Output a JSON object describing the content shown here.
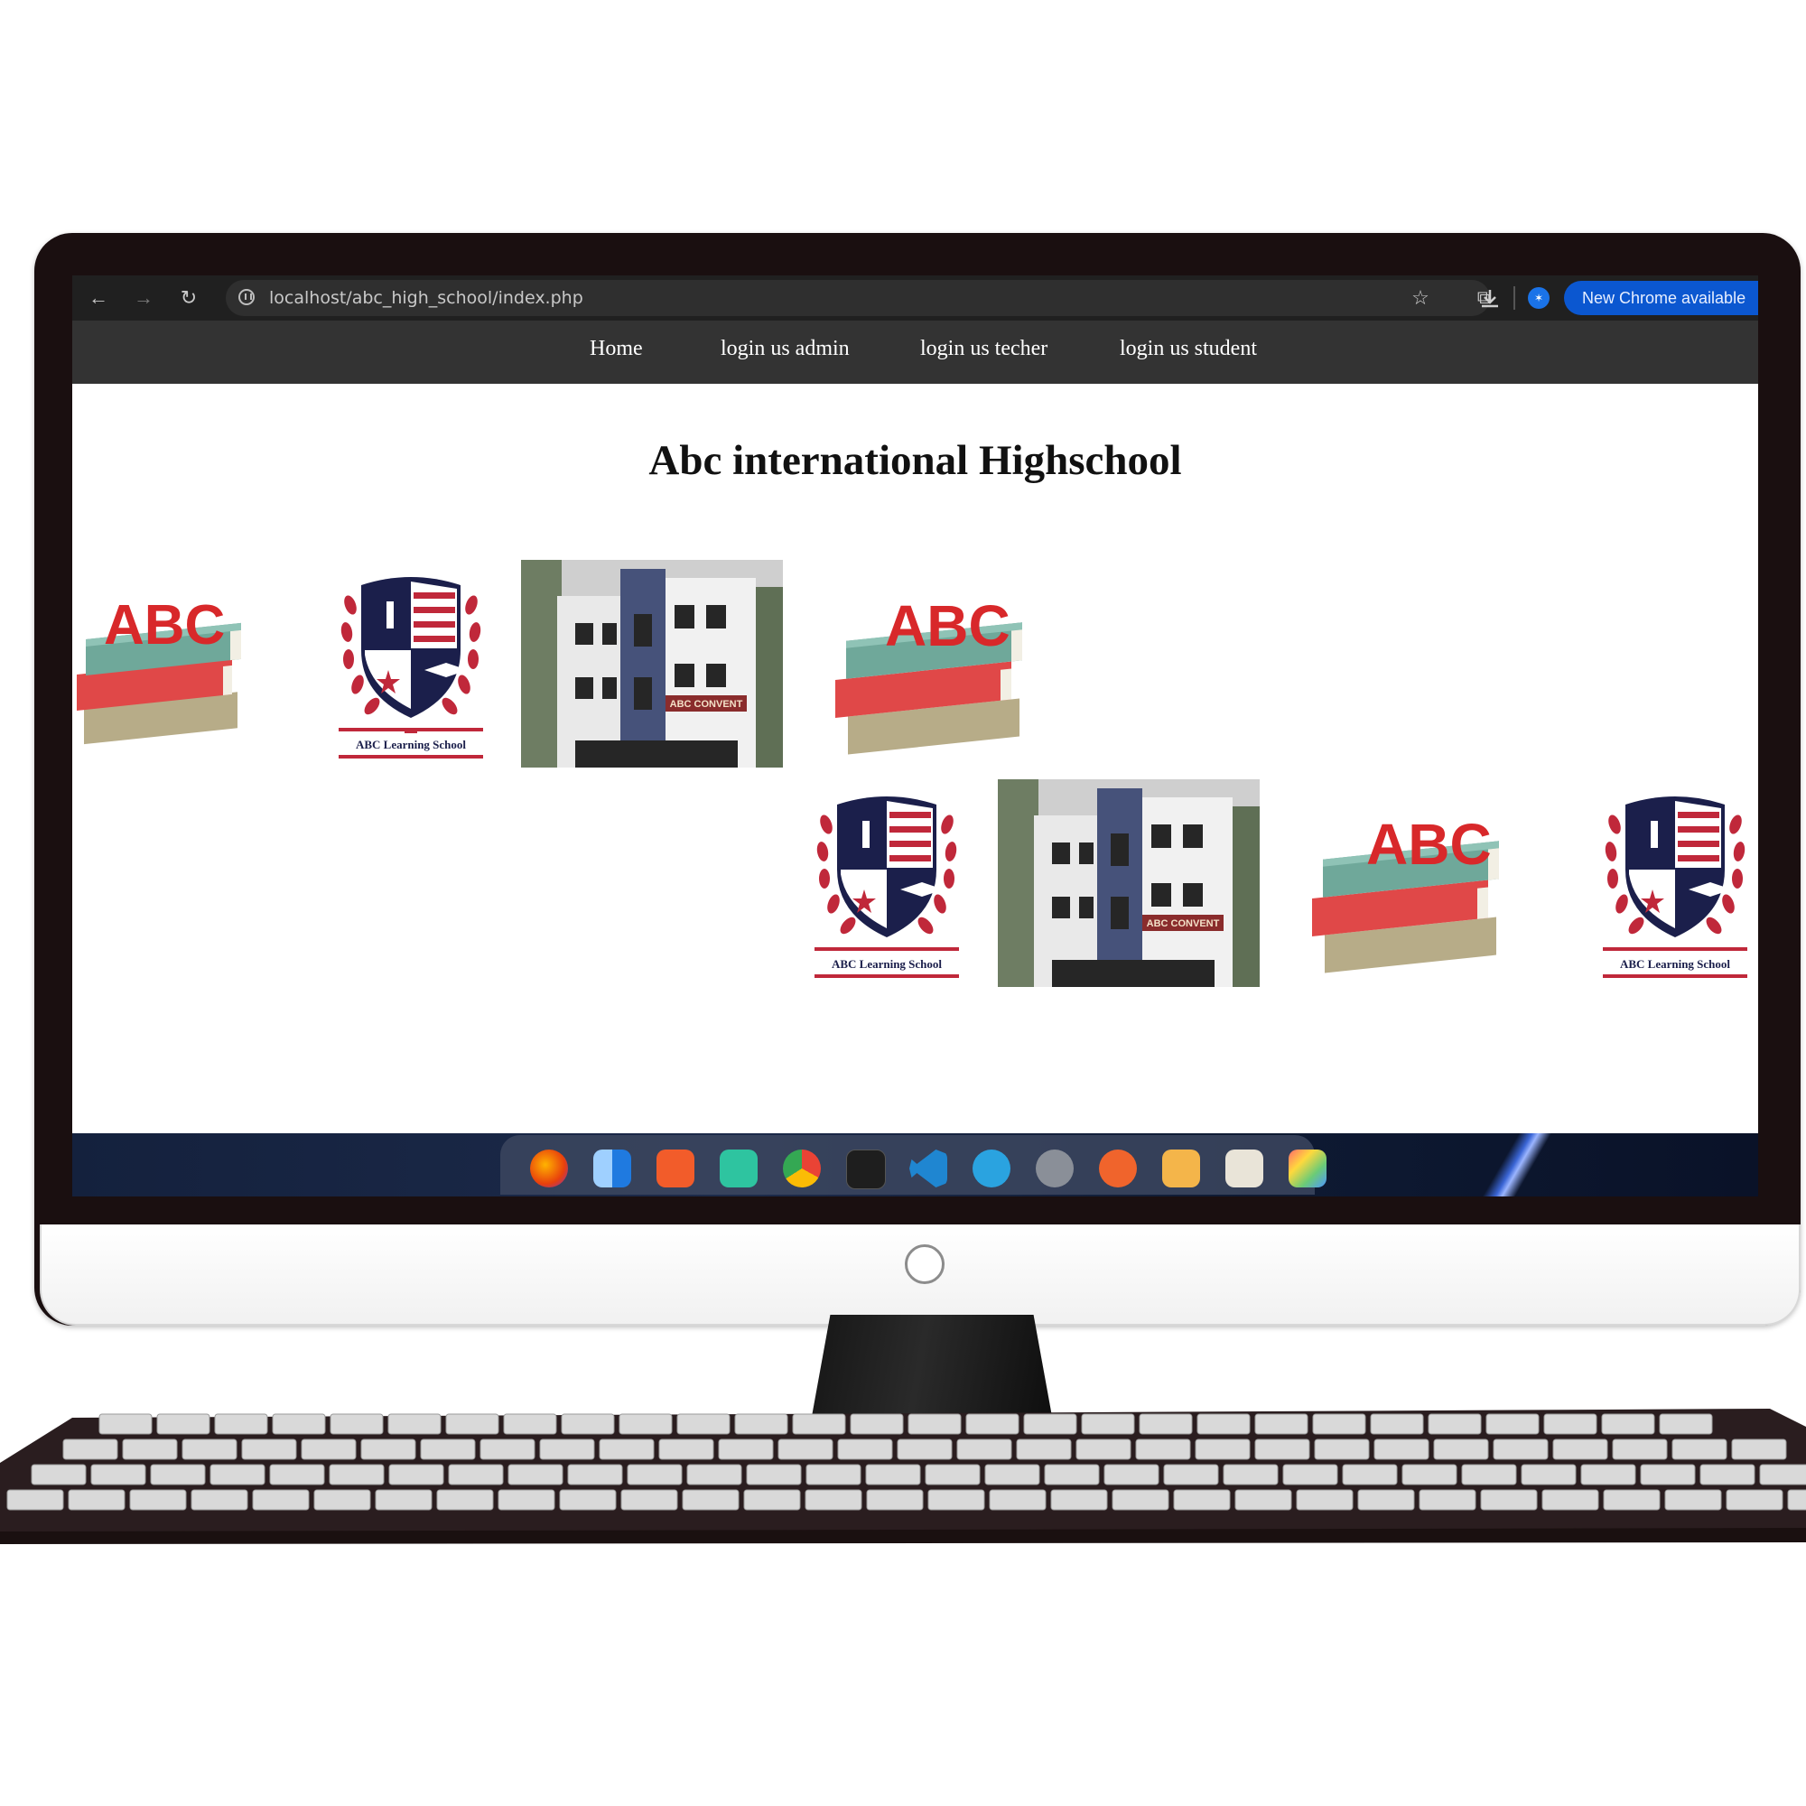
{
  "browser": {
    "url": "localhost/abc_high_school/index.php",
    "update_label": "New Chrome available",
    "profile_initial": "✶"
  },
  "nav": {
    "items": [
      {
        "label": "Home"
      },
      {
        "label": "login us admin"
      },
      {
        "label": "login us techer"
      },
      {
        "label": "login us student"
      }
    ]
  },
  "page": {
    "heading": "Abc international Highschool",
    "emblem_text": "ABC Learning School",
    "books_text": "ABC",
    "building_sign": "ABC CONVENT"
  },
  "colors": {
    "nav_bg": "#333333",
    "browser_bg": "#202020",
    "accent_blue": "#0b57d0",
    "emblem_navy": "#1b1f4b",
    "emblem_red": "#c0283a"
  },
  "icons": [
    "back-icon",
    "forward-icon",
    "reload-icon",
    "site-info-icon",
    "bookmark-star-icon",
    "extensions-icon",
    "download-icon",
    "firefox-icon",
    "finder-icon",
    "app-store-icon",
    "maps-icon",
    "chrome-icon",
    "terminal-icon",
    "vscode-icon",
    "telegram-icon",
    "settings-icon",
    "swift-icon",
    "archive-icon",
    "notes-icon",
    "photos-icon"
  ]
}
